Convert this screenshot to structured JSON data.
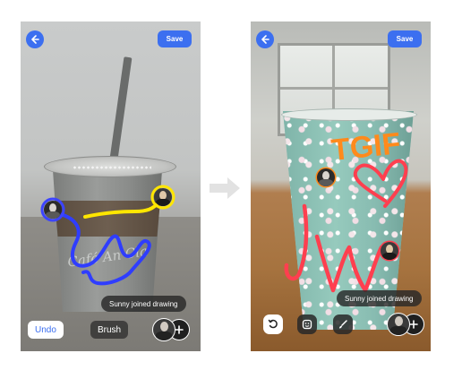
{
  "left_screen": {
    "save_label": "Save",
    "toast_text": "Sunny joined drawing",
    "undo_label": "Undo",
    "brush_label": "Brush",
    "cup_print": "Café An Cla",
    "colors": {
      "accent": "#3c6ff0",
      "ink_blue": "#2f3dff",
      "ink_yellow": "#ffe600"
    },
    "icons": [
      "back-arrow-icon",
      "add-icon"
    ]
  },
  "right_screen": {
    "save_label": "Save",
    "toast_text": "Sunny joined drawing",
    "drawn_text": {
      "top": "TGIF",
      "bottom": "JW"
    },
    "colors": {
      "accent": "#3c6ff0",
      "ink_orange": "#ff8a1c",
      "ink_red": "#ff3f4f"
    },
    "icons": [
      "back-arrow-icon",
      "undo-icon",
      "sticker-icon",
      "brush-icon",
      "add-icon"
    ]
  },
  "transition_arrow": "arrow-right-icon"
}
